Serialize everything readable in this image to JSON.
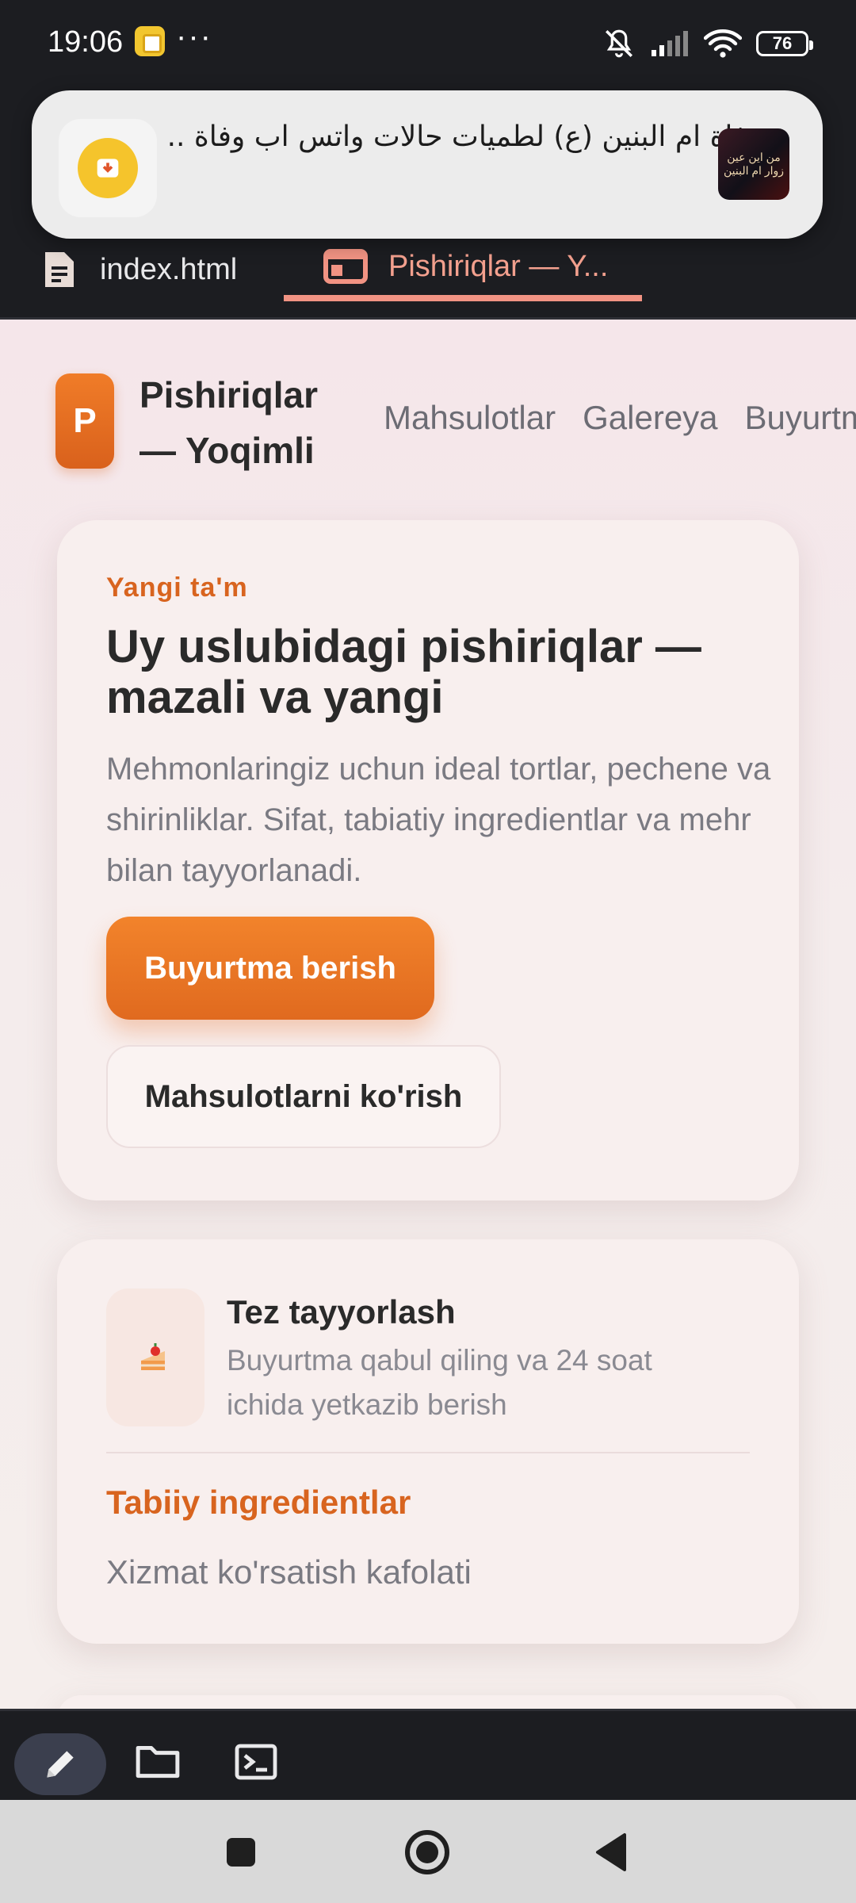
{
  "status_bar": {
    "time": "19:06",
    "more": "···",
    "battery": "76",
    "icons": [
      "app-notification-icon",
      "mute-bell-icon",
      "signal-icon",
      "wifi-icon",
      "battery-icon"
    ]
  },
  "notification": {
    "text": "وفاة ام البنين (ع) لطميات حالات واتس اب وفاة ..",
    "thumb_text": "من اين عين زوار ام البنين"
  },
  "editor_tabs": [
    {
      "label": "index.html",
      "icon": "file-icon",
      "active": false
    },
    {
      "label": "Pishiriqlar — Y...",
      "icon": "browser-preview-icon",
      "active": true
    }
  ],
  "site": {
    "logo_letter": "P",
    "brand": "Pishiriqlar — Yoqimli",
    "nav": [
      "Mahsulotlar",
      "Galereya",
      "Buyurtma"
    ],
    "hero": {
      "eyebrow": "Yangi ta'm",
      "title": "Uy uslubidagi pishiriqlar — mazali va yangi",
      "description": "Mehmonlaringiz uchun ideal tortlar, pechene va shirinliklar. Sifat, tabiatiy ingredientlar va mehr bilan tayyorlanadi.",
      "primary_button": "Buyurtma berish",
      "secondary_button": "Mahsulotlarni ko'rish"
    },
    "features": {
      "icon": "cake-icon",
      "title": "Tez tayyorlash",
      "description": "Buyurtma qabul qiling va 24 soat ichida yetkazib berish",
      "item2": "Tabiiy ingredientlar",
      "item3": "Xizmat ko'rsatish kafolati"
    }
  },
  "colors": {
    "accent": "#e8731f",
    "accent_text": "#d8641f",
    "tab_active": "#f3a08e",
    "dark_bg": "#1c1d21"
  },
  "toolbar": [
    "edit-pencil-icon",
    "folder-icon",
    "terminal-icon"
  ],
  "navigation_bar": [
    "recent-apps-square-icon",
    "home-circle-icon",
    "back-triangle-icon"
  ]
}
